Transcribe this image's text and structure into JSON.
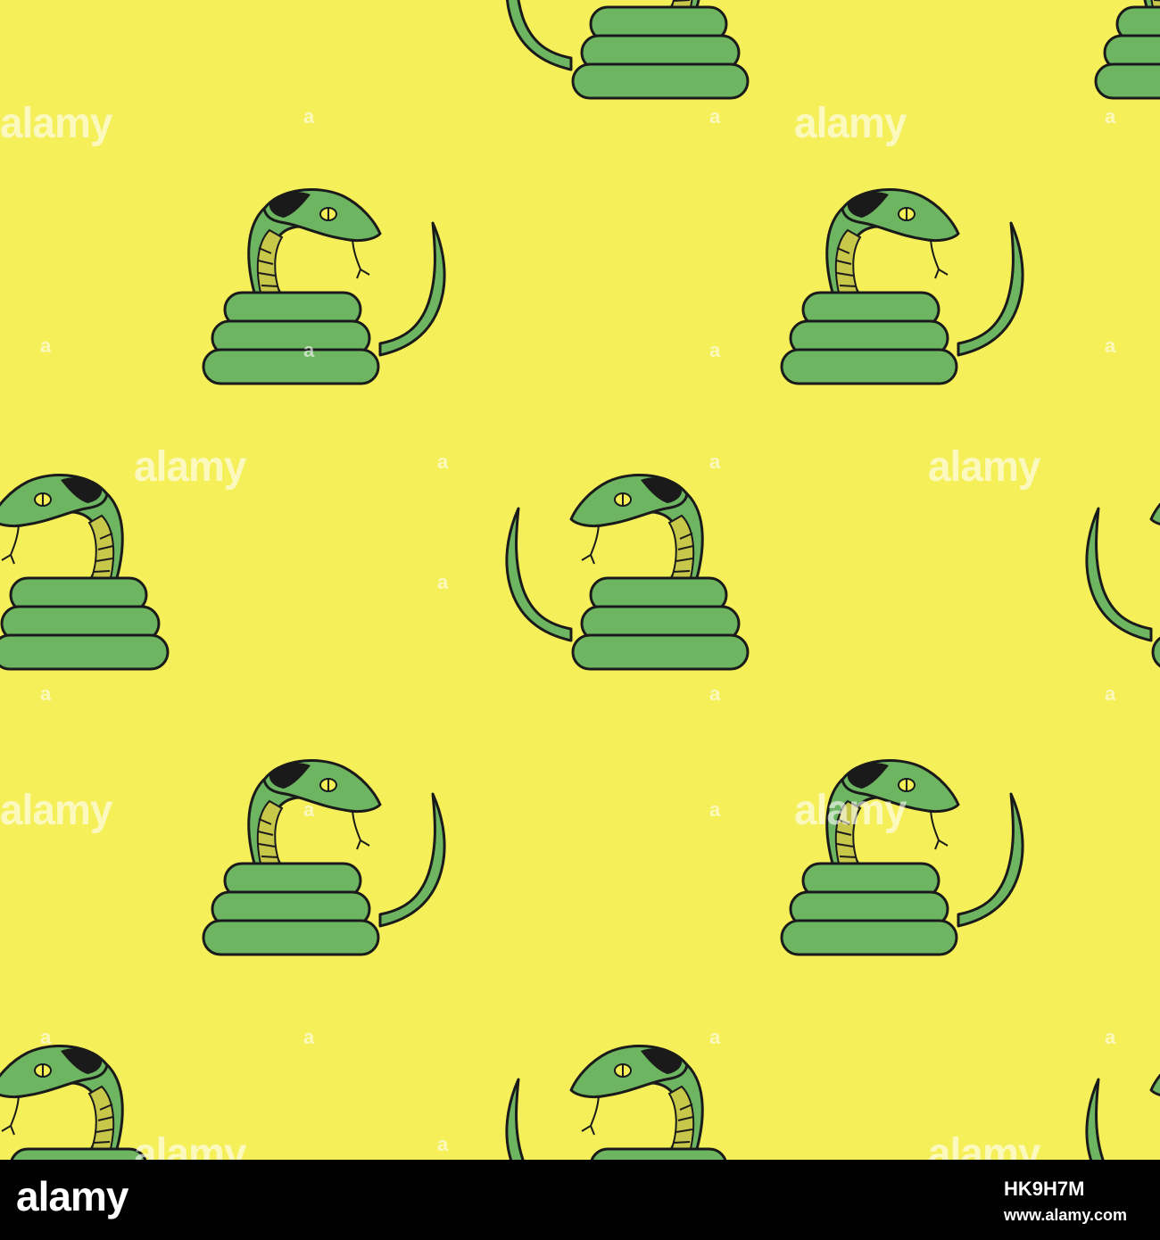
{
  "image": {
    "description_type": "seamless pattern stock image",
    "background_color": "#f5ef5a",
    "snake_body_color": "#6db560",
    "snake_belly_color": "#c7c74a",
    "outline_color": "#1a1a1a",
    "icon": "coiled-green-snake"
  },
  "watermark": {
    "text": "alamy",
    "small_text": "a"
  },
  "footer": {
    "logo": "alamy",
    "image_id": "HK9H7M",
    "url": "www.alamy.com"
  }
}
